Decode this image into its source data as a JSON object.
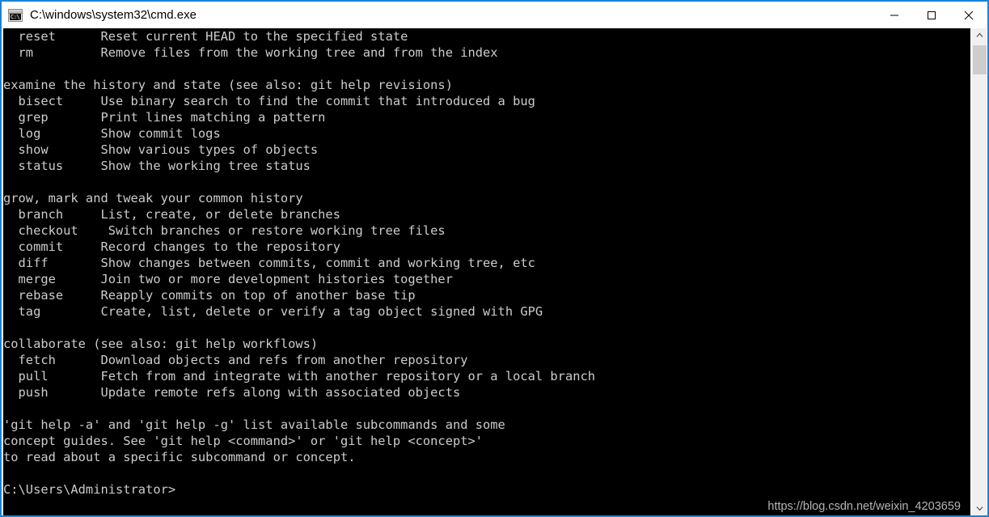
{
  "window": {
    "title": "C:\\windows\\system32\\cmd.exe",
    "icon": "cmd-console-icon",
    "icon_glyph": "C:\\_",
    "accent_color": "#1883d7",
    "titlebar_bg": "#ffffff",
    "terminal_bg": "#000000",
    "terminal_fg": "#cccccc"
  },
  "titlebar": {
    "minimize_label": "minimize",
    "maximize_label": "maximize",
    "close_label": "close"
  },
  "terminal": {
    "lines": [
      "  reset      Reset current HEAD to the specified state",
      "  rm         Remove files from the working tree and from the index",
      "",
      "examine the history and state (see also: git help revisions)",
      "  bisect     Use binary search to find the commit that introduced a bug",
      "  grep       Print lines matching a pattern",
      "  log        Show commit logs",
      "  show       Show various types of objects",
      "  status     Show the working tree status",
      "",
      "grow, mark and tweak your common history",
      "  branch     List, create, or delete branches",
      "  checkout    Switch branches or restore working tree files",
      "  commit     Record changes to the repository",
      "  diff       Show changes between commits, commit and working tree, etc",
      "  merge      Join two or more development histories together",
      "  rebase     Reapply commits on top of another base tip",
      "  tag        Create, list, delete or verify a tag object signed with GPG",
      "",
      "collaborate (see also: git help workflows)",
      "  fetch      Download objects and refs from another repository",
      "  pull       Fetch from and integrate with another repository or a local branch",
      "  push       Update remote refs along with associated objects",
      "",
      "'git help -a' and 'git help -g' list available subcommands and some",
      "concept guides. See 'git help <command>' or 'git help <concept>'",
      "to read about a specific subcommand or concept.",
      "",
      "C:\\Users\\Administrator>"
    ],
    "prompt": "C:\\Users\\Administrator>",
    "cursor": "_"
  },
  "watermark": {
    "text": "https://blog.csdn.net/weixin_4203659"
  },
  "scrollbar": {
    "up_arrow": "chevron-up-icon",
    "down_arrow": "chevron-down-icon",
    "thumb_label": "scroll-thumb"
  }
}
